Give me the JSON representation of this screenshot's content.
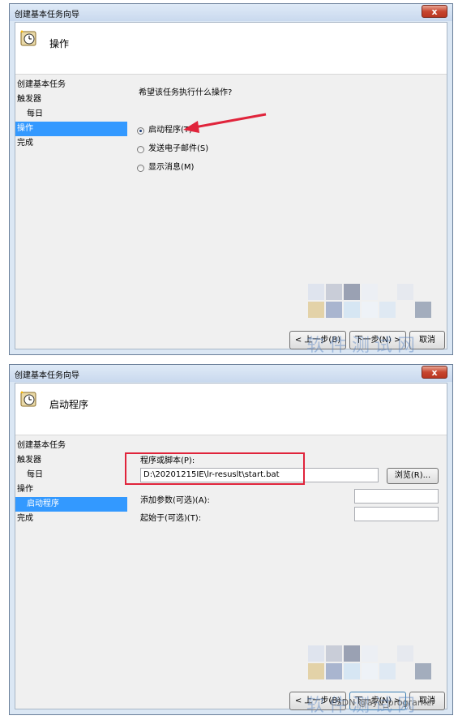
{
  "window1": {
    "title": "创建基本任务向导",
    "close_label": "x",
    "header_title": "操作",
    "nav": [
      {
        "label": "创建基本任务",
        "sub": false,
        "selected": false
      },
      {
        "label": "触发器",
        "sub": false,
        "selected": false
      },
      {
        "label": "每日",
        "sub": true,
        "selected": false
      },
      {
        "label": "操作",
        "sub": false,
        "selected": true
      },
      {
        "label": "完成",
        "sub": false,
        "selected": false
      }
    ],
    "question": "希望该任务执行什么操作?",
    "options": [
      {
        "label": "启动程序(T)",
        "checked": true
      },
      {
        "label": "发送电子邮件(S)",
        "checked": false
      },
      {
        "label": "显示消息(M)",
        "checked": false
      }
    ],
    "buttons": {
      "back": "< 上一步(B)",
      "next": "下一步(N) >",
      "cancel": "取消"
    }
  },
  "window2": {
    "title": "创建基本任务向导",
    "close_label": "x",
    "header_title": "启动程序",
    "nav": [
      {
        "label": "创建基本任务",
        "sub": false,
        "selected": false
      },
      {
        "label": "触发器",
        "sub": false,
        "selected": false
      },
      {
        "label": "每日",
        "sub": true,
        "selected": false
      },
      {
        "label": "操作",
        "sub": false,
        "selected": false
      },
      {
        "label": "启动程序",
        "sub": true,
        "selected": true
      },
      {
        "label": "完成",
        "sub": false,
        "selected": false
      }
    ],
    "program_label": "程序或脚本(P):",
    "program_value": "D:\\20201215IE\\lr-resuslt\\start.bat",
    "browse_label": "浏览(R)...",
    "args_label": "添加参数(可选)(A):",
    "args_value": "",
    "start_label": "起始于(可选)(T):",
    "start_value": "",
    "buttons": {
      "back": "< 上一步(B)",
      "next": "下一步(N) >",
      "cancel": "取消"
    }
  },
  "watermark": "软件测试网",
  "csdn_credit": "CSDN @ayu_programer",
  "colors": {
    "selection": "#3399ff",
    "annotation_red": "#e0243b",
    "window_frame": "#dbe7f4"
  }
}
